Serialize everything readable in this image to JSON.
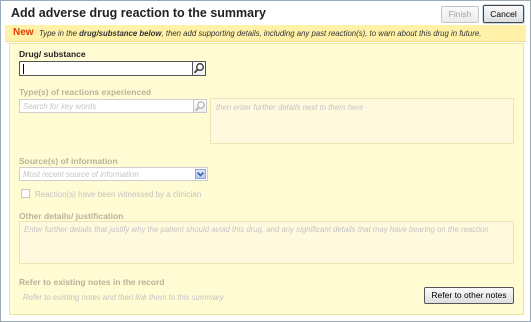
{
  "window": {
    "title": "Add adverse drug reaction to the summary",
    "finish_label": "Finish",
    "cancel_label": "Cancel"
  },
  "banner": {
    "badge": "New",
    "text_before": "Type in the ",
    "text_emphasis": "drug/substance below",
    "text_after": ", then add supporting details, including any past reaction(s), to warn about this drug in future."
  },
  "drug": {
    "label": "Drug/ substance",
    "value": ""
  },
  "reactions": {
    "label": "Type(s) of reactions experienced",
    "search_placeholder": "Search for key words",
    "details_hint": "then enter further details next to them here"
  },
  "sources": {
    "label": "Source(s) of information",
    "select_value": "Most recent source of information",
    "witnessed_label": "Reaction(s) have been witnessed by a clinician",
    "witnessed_checked": false
  },
  "other_details": {
    "label": "Other details/ justification",
    "placeholder": "Enter further details that justify why the patient should avoid this drug, and any significant details that may have bearing on the reaction"
  },
  "notes": {
    "label": "Refer to existing notes in the record",
    "hint": "Refer to existing notes and then link them to this summary",
    "button_label": "Refer to other notes"
  },
  "icons": {
    "search": "search-icon",
    "dropdown": "chevron-down-icon"
  },
  "colors": {
    "badge": "#e04000",
    "panel_bg": "#fffbd2",
    "banner_bg": "#fff1a8",
    "dropdown_accent": "#3b63b8"
  }
}
